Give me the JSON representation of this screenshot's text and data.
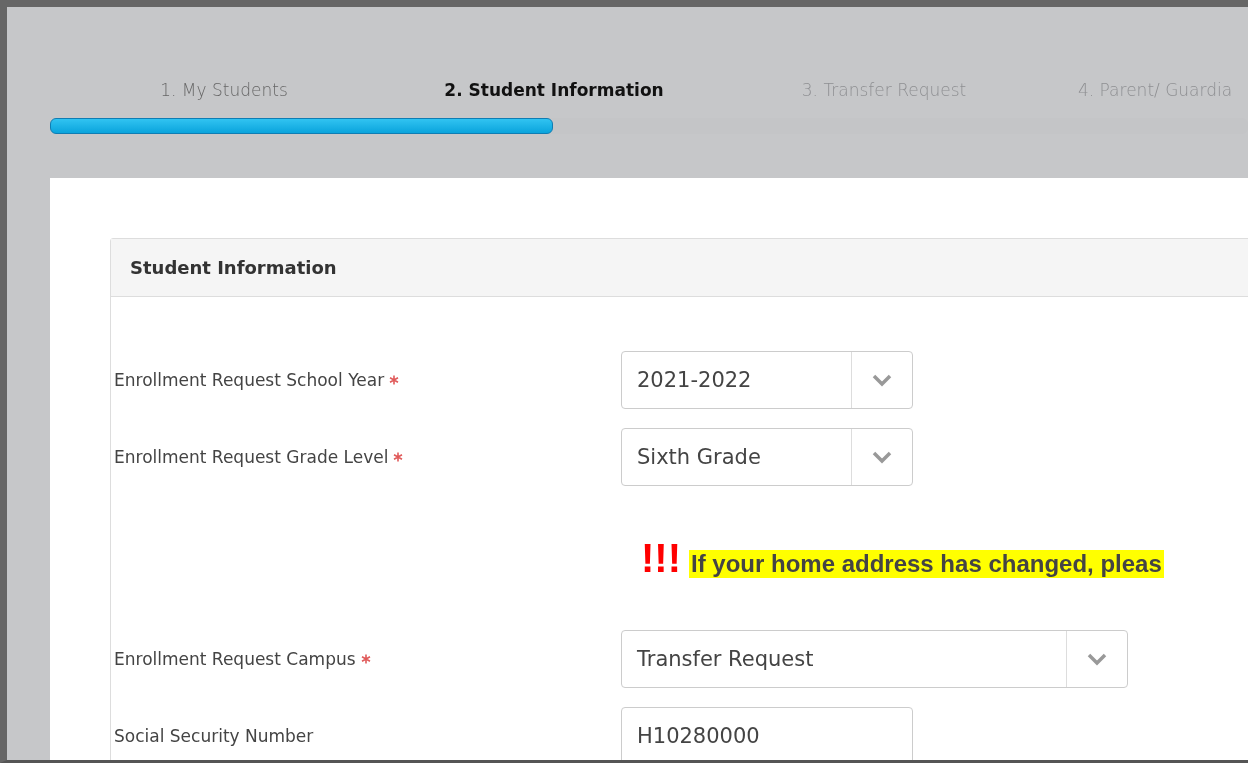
{
  "steps": [
    {
      "label": "1. My Students",
      "selected": false,
      "disabled": false
    },
    {
      "label": "2. Student Information",
      "selected": true,
      "disabled": false
    },
    {
      "label": "3. Transfer Request",
      "selected": false,
      "disabled": true
    },
    {
      "label": "4. Parent/ Guardia",
      "selected": false,
      "disabled": true
    }
  ],
  "progress": {
    "level": 0.42
  },
  "card": {
    "title": "Student Information",
    "fields": [
      {
        "label": "Enrollment Request School Year",
        "required": true,
        "kind": "select",
        "value": "2021-2022",
        "wide": false
      },
      {
        "label": "Enrollment Request Grade Level",
        "required": true,
        "kind": "select",
        "value": "Sixth Grade",
        "wide": false
      },
      {
        "kind": "notice",
        "mark": "!!!",
        "text": "If your home address has changed, pleas"
      },
      {
        "label": "Enrollment Request Campus",
        "required": true,
        "kind": "select",
        "value": "Transfer Request",
        "wide": true
      },
      {
        "label": "Social Security Number",
        "required": false,
        "kind": "text",
        "value": "H10280000",
        "wide": false
      }
    ]
  }
}
